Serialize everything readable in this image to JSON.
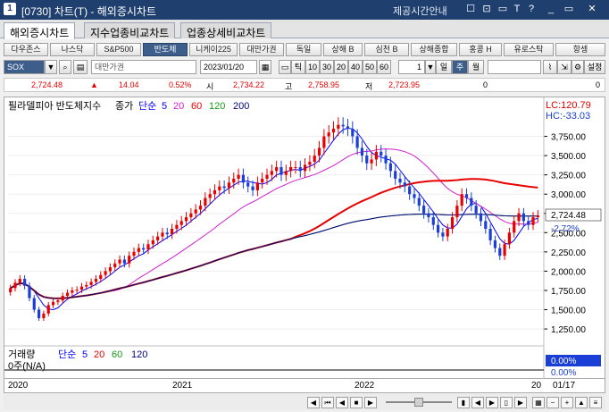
{
  "window": {
    "number": "1",
    "title": "[0730] 차트(T) - 해외증시차트",
    "right_text": "제공시간안내",
    "controls": [
      "☐",
      "⊡",
      "▭",
      "T",
      "?",
      "_",
      "▭",
      "✕"
    ]
  },
  "tabs": [
    {
      "label": "해외증시차트",
      "active": true
    },
    {
      "label": "지수업종비교차트",
      "active": false
    },
    {
      "label": "업종상세비교차트",
      "active": false
    }
  ],
  "index_buttons": [
    {
      "label": "다우존스",
      "selected": false
    },
    {
      "label": "나스닥",
      "selected": false
    },
    {
      "label": "S&P500",
      "selected": false
    },
    {
      "label": "반도체",
      "selected": true
    },
    {
      "label": "니케이225",
      "selected": false
    },
    {
      "label": "대만가권",
      "selected": false
    },
    {
      "label": "독일",
      "selected": false
    },
    {
      "label": "상해 B",
      "selected": false
    },
    {
      "label": "심천 B",
      "selected": false
    },
    {
      "label": "상해종합",
      "selected": false
    },
    {
      "label": "홍콩 H",
      "selected": false
    },
    {
      "label": "유로스탁",
      "selected": false
    },
    {
      "label": "항셍",
      "selected": false
    }
  ],
  "toolbar": {
    "symbol": "SOX",
    "market_name": "대만가권",
    "date": "2023/01/20",
    "periods": [
      "틱",
      "10",
      "30",
      "20",
      "40",
      "50",
      "60"
    ],
    "count": "1",
    "chart_types": [
      "일",
      "주",
      "월"
    ],
    "active_chart_type": "주",
    "settings_label": "설정"
  },
  "price": {
    "current": "2,724.48",
    "change": "14.04",
    "change_pct": "0.52%",
    "open_label": "시",
    "open": "2,734.22",
    "high_label": "고",
    "high": "2,758.95",
    "low_label": "저",
    "low": "2,723.95",
    "volume": "0",
    "extra": "0"
  },
  "legend": {
    "name": "필라델피아 반도체지수",
    "close_label": "종가",
    "ma_label": "단순",
    "mas": [
      {
        "period": "5",
        "color": "#0000ff"
      },
      {
        "period": "20",
        "color": "#d21fd2"
      },
      {
        "period": "60",
        "color": "#e80000"
      },
      {
        "period": "120",
        "color": "#169a16"
      },
      {
        "period": "200",
        "color": "#000080"
      }
    ],
    "lc": "LC:120.79",
    "hc": "HC:-33.03"
  },
  "volume_legend": {
    "label": "거래량",
    "ma_label": "단순",
    "mas": [
      {
        "period": "5",
        "color": "#0000ff"
      },
      {
        "period": "20",
        "color": "#e80000"
      },
      {
        "period": "60",
        "color": "#169a16"
      },
      {
        "period": "120",
        "color": "#000080"
      }
    ],
    "value": "0주(N/A)",
    "pct_top": "0.00%",
    "pct_bottom": "0.00%"
  },
  "y_axis": {
    "ticks": [
      "3,750.00",
      "3,500.00",
      "3,250.00",
      "3,000.00",
      "2,750.00",
      "2,500.00",
      "2,250.00",
      "2,000.00",
      "1,750.00",
      "1,500.00",
      "1,250.00"
    ],
    "current_label": "2,724.48",
    "current_pct": "-2.72%"
  },
  "x_axis": {
    "labels": [
      "2020",
      "2021",
      "2022",
      "20"
    ],
    "right_date": "01/17"
  },
  "colors": {
    "up": "#e80000",
    "down": "#1a3fd6",
    "ma5": "#0000ff",
    "ma20": "#d21fd2",
    "ma60": "#e80000",
    "ma120": "#169a16",
    "ma200": "#000080",
    "titlebar": "#1f3f6e"
  },
  "chart_data": {
    "type": "candlestick",
    "title": "필라델피아 반도체지수",
    "interval": "weekly",
    "x_start": "2020",
    "x_end": "2023/01/20",
    "ylim": [
      1100,
      4000
    ],
    "close": [
      1780,
      1850,
      1900,
      1810,
      1650,
      1500,
      1390,
      1450,
      1560,
      1600,
      1620,
      1680,
      1720,
      1750,
      1760,
      1800,
      1820,
      1860,
      1900,
      1950,
      2000,
      2050,
      2100,
      2150,
      2100,
      2200,
      2250,
      2300,
      2280,
      2350,
      2400,
      2450,
      2500,
      2480,
      2550,
      2600,
      2650,
      2700,
      2750,
      2800,
      2850,
      2950,
      3000,
      3050,
      3100,
      3080,
      3150,
      3200,
      3250,
      3150,
      3100,
      3050,
      3150,
      3200,
      3250,
      3300,
      3350,
      3250,
      3300,
      3350,
      3350,
      3300,
      3380,
      3420,
      3500,
      3600,
      3750,
      3800,
      3850,
      3900,
      3880,
      3850,
      3750,
      3600,
      3500,
      3400,
      3450,
      3550,
      3500,
      3400,
      3300,
      3200,
      3150,
      3100,
      3000,
      2950,
      2850,
      2750,
      2700,
      2600,
      2500,
      2450,
      2550,
      2700,
      2850,
      3000,
      2950,
      2850,
      2750,
      2650,
      2550,
      2400,
      2300,
      2200,
      2350,
      2500,
      2650,
      2750,
      2650,
      2600,
      2700,
      2724.48
    ],
    "series": [
      {
        "name": "5",
        "color": "#0000ff"
      },
      {
        "name": "20",
        "color": "#d21fd2"
      },
      {
        "name": "60",
        "color": "#e80000"
      },
      {
        "name": "120",
        "color": "#169a16"
      },
      {
        "name": "200",
        "color": "#000080"
      }
    ]
  }
}
